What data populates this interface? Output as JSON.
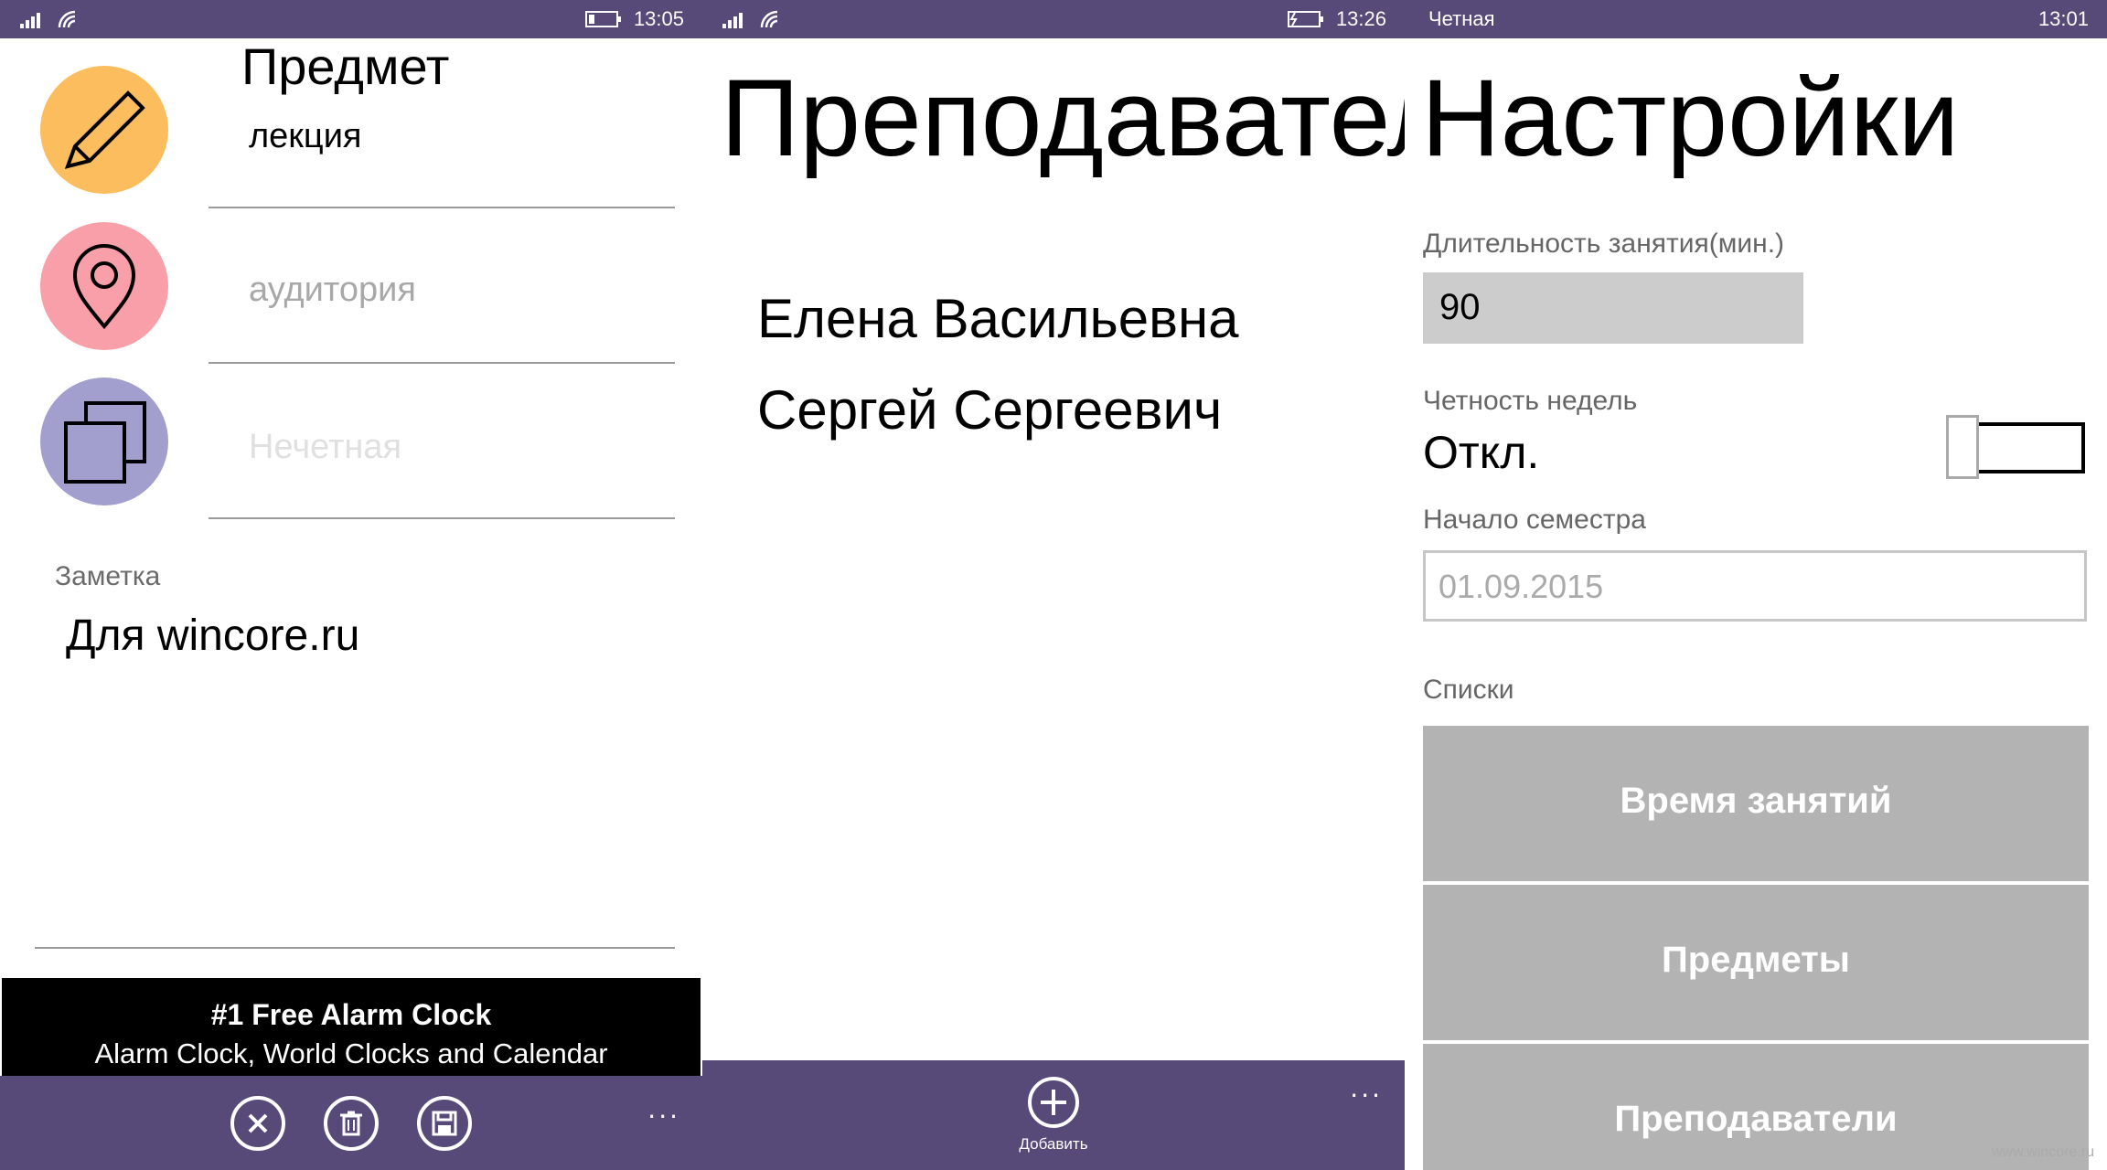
{
  "screen1": {
    "status_time": "13:05",
    "title": "Предмет",
    "subject_value": "лекция",
    "room_placeholder": "аудитория",
    "week_placeholder": "Нечетная",
    "note_label": "Заметка",
    "note_text": "Для wincore.ru",
    "ad": {
      "title": "#1 Free Alarm Clock",
      "subtitle": "Alarm Clock, World Clocks and Calendar"
    },
    "appbar_more": "..."
  },
  "screen2": {
    "status_time": "13:26",
    "title": "Преподавател",
    "teachers": [
      "Елена Васильевна",
      "Сергей Сергеевич"
    ],
    "add_label": "Добавить",
    "appbar_more": "..."
  },
  "screen3": {
    "status_left": "Четная",
    "status_time": "13:01",
    "title": "Настройки",
    "duration_label": "Длительность занятия(мин.)",
    "duration_value": "90",
    "parity_label": "Четность недель",
    "parity_state": "Откл.",
    "semester_label": "Начало семестра",
    "semester_value": "01.09.2015",
    "lists_label": "Списки",
    "buttons": [
      "Время занятий",
      "Предметы",
      "Преподаватели"
    ],
    "watermark": "www.wincore.ru"
  },
  "colors": {
    "accent": "#574a78",
    "circle_subject": "#fbbd5e",
    "circle_room": "#f99fa9",
    "circle_week": "#a29ece",
    "list_button": "#b3b3b3"
  },
  "icons": [
    "signal-icon",
    "wifi-icon",
    "battery-icon",
    "pencil-icon",
    "location-pin-icon",
    "pages-icon",
    "cancel-icon",
    "delete-icon",
    "save-icon",
    "add-icon"
  ]
}
